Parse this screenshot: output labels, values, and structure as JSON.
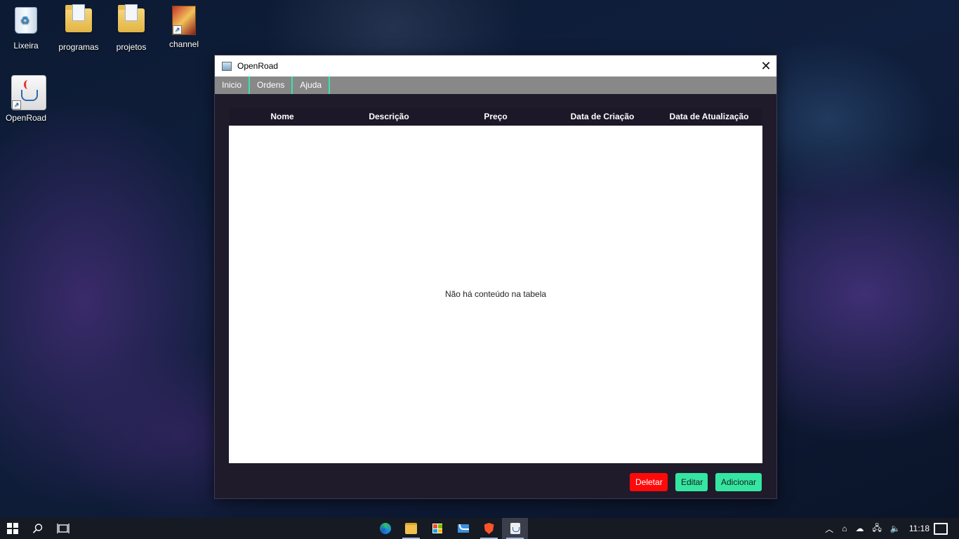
{
  "desktop": {
    "icons": [
      {
        "label": "Lixeira"
      },
      {
        "label": "programas"
      },
      {
        "label": "projetos"
      },
      {
        "label": "channel"
      },
      {
        "label": "OpenRoad"
      }
    ]
  },
  "window": {
    "title": "OpenRoad",
    "close_glyph": "✕",
    "menu": [
      {
        "label": "Inicio"
      },
      {
        "label": "Ordens"
      },
      {
        "label": "Ajuda"
      }
    ],
    "table": {
      "columns": [
        "Nome",
        "Descrição",
        "Preço",
        "Data de Criação",
        "Data de Atualização"
      ],
      "rows": [],
      "empty_text": "Não há conteúdo na tabela"
    },
    "buttons": {
      "delete_label": "Deletar",
      "edit_label": "Editar",
      "add_label": "Adicionar"
    },
    "colors": {
      "accent": "#35e6a2",
      "danger": "#ff0a0a",
      "window_bg": "#1f1b2b",
      "menubar_bg": "#888888"
    }
  },
  "taskbar": {
    "search_icon": "search-icon",
    "task_view_icon": "task-view-icon",
    "pinned_apps": [
      "edge-icon",
      "file-explorer-icon",
      "store-icon",
      "mail-icon",
      "brave-icon",
      "java-icon"
    ],
    "clock": "11:18"
  }
}
